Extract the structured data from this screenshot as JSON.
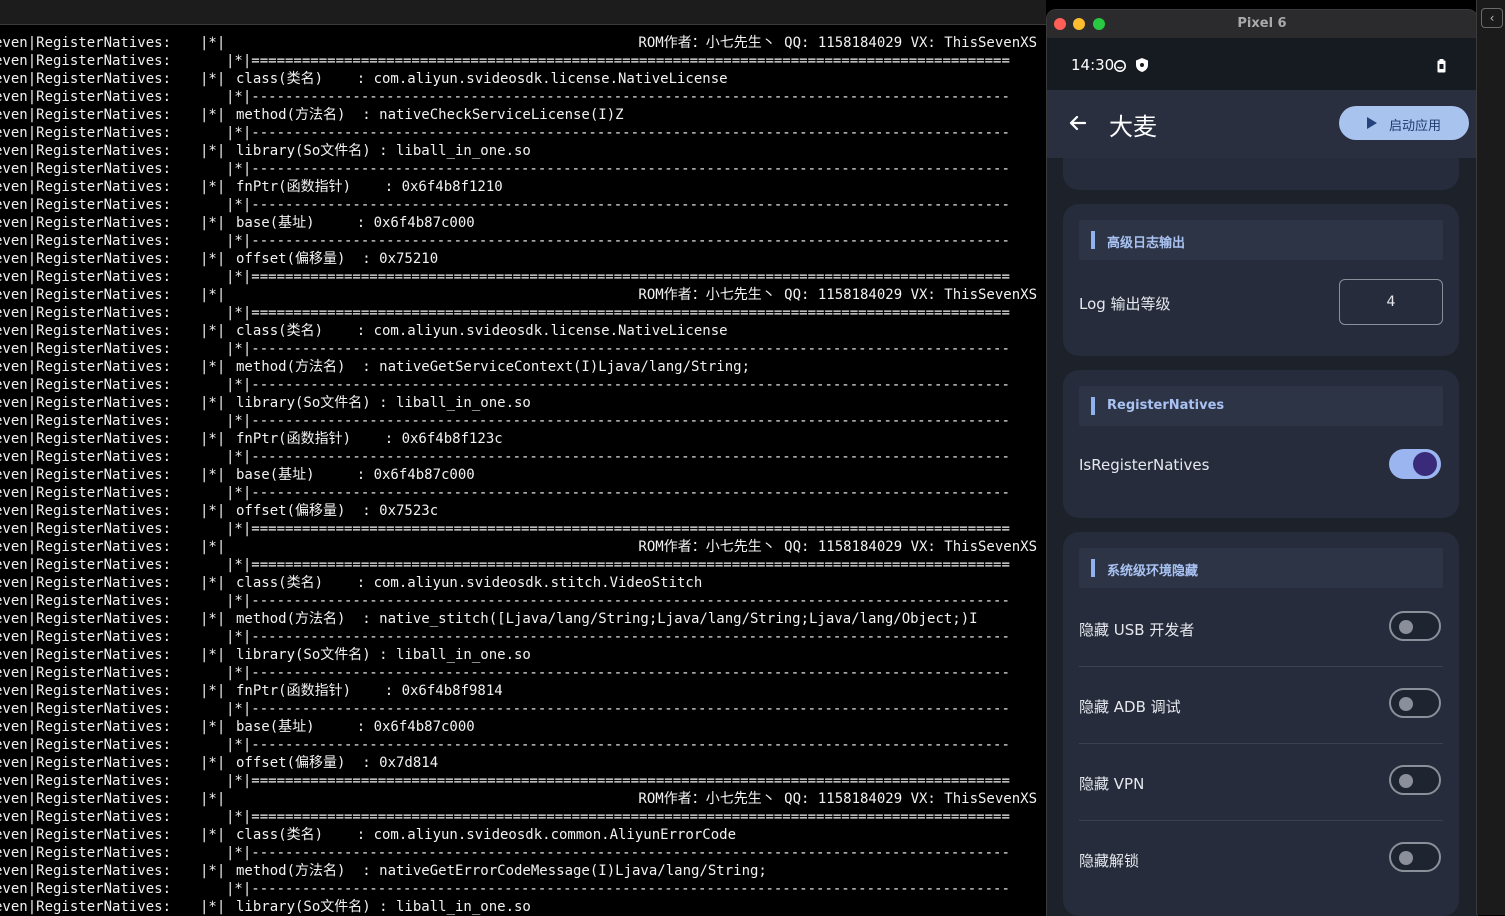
{
  "terminal": {
    "lines": [
      {
        "prefix": "even|RegisterNatives:",
        "kind": "header",
        "text": "ROM作者：小七先生丶 QQ: 1158184029 VX: ThisSevenXS"
      },
      {
        "prefix": "even|RegisterNatives:",
        "kind": "rule",
        "text": "|*|=========================================================================================="
      },
      {
        "prefix": "even|RegisterNatives:",
        "kind": "field",
        "text": "class(类名)    : com.aliyun.svideosdk.license.NativeLicense"
      },
      {
        "prefix": "even|RegisterNatives:",
        "kind": "rule",
        "text": "|*|------------------------------------------------------------------------------------------"
      },
      {
        "prefix": "even|RegisterNatives:",
        "kind": "field",
        "text": "method(方法名)  : nativeCheckServiceLicense(I)Z"
      },
      {
        "prefix": "even|RegisterNatives:",
        "kind": "rule",
        "text": "|*|------------------------------------------------------------------------------------------"
      },
      {
        "prefix": "even|RegisterNatives:",
        "kind": "field",
        "text": "library(So文件名) : liball_in_one.so"
      },
      {
        "prefix": "even|RegisterNatives:",
        "kind": "rule",
        "text": "|*|------------------------------------------------------------------------------------------"
      },
      {
        "prefix": "even|RegisterNatives:",
        "kind": "field",
        "text": "fnPtr(函数指针)    : 0x6f4b8f1210"
      },
      {
        "prefix": "even|RegisterNatives:",
        "kind": "rule",
        "text": "|*|------------------------------------------------------------------------------------------"
      },
      {
        "prefix": "even|RegisterNatives:",
        "kind": "field",
        "text": "base(基址)     : 0x6f4b87c000"
      },
      {
        "prefix": "even|RegisterNatives:",
        "kind": "rule",
        "text": "|*|------------------------------------------------------------------------------------------"
      },
      {
        "prefix": "even|RegisterNatives:",
        "kind": "field",
        "text": "offset(偏移量)  : 0x75210"
      },
      {
        "prefix": "even|RegisterNatives:",
        "kind": "rule",
        "text": "|*|=========================================================================================="
      },
      {
        "prefix": "even|RegisterNatives:",
        "kind": "header",
        "text": "ROM作者：小七先生丶 QQ: 1158184029 VX: ThisSevenXS"
      },
      {
        "prefix": "even|RegisterNatives:",
        "kind": "rule",
        "text": "|*|=========================================================================================="
      },
      {
        "prefix": "even|RegisterNatives:",
        "kind": "field",
        "text": "class(类名)    : com.aliyun.svideosdk.license.NativeLicense"
      },
      {
        "prefix": "even|RegisterNatives:",
        "kind": "rule",
        "text": "|*|------------------------------------------------------------------------------------------"
      },
      {
        "prefix": "even|RegisterNatives:",
        "kind": "field",
        "text": "method(方法名)  : nativeGetServiceContext(I)Ljava/lang/String;"
      },
      {
        "prefix": "even|RegisterNatives:",
        "kind": "rule",
        "text": "|*|------------------------------------------------------------------------------------------"
      },
      {
        "prefix": "even|RegisterNatives:",
        "kind": "field",
        "text": "library(So文件名) : liball_in_one.so"
      },
      {
        "prefix": "even|RegisterNatives:",
        "kind": "rule",
        "text": "|*|------------------------------------------------------------------------------------------"
      },
      {
        "prefix": "even|RegisterNatives:",
        "kind": "field",
        "text": "fnPtr(函数指针)    : 0x6f4b8f123c"
      },
      {
        "prefix": "even|RegisterNatives:",
        "kind": "rule",
        "text": "|*|------------------------------------------------------------------------------------------"
      },
      {
        "prefix": "even|RegisterNatives:",
        "kind": "field",
        "text": "base(基址)     : 0x6f4b87c000"
      },
      {
        "prefix": "even|RegisterNatives:",
        "kind": "rule",
        "text": "|*|------------------------------------------------------------------------------------------"
      },
      {
        "prefix": "even|RegisterNatives:",
        "kind": "field",
        "text": "offset(偏移量)  : 0x7523c"
      },
      {
        "prefix": "even|RegisterNatives:",
        "kind": "rule",
        "text": "|*|=========================================================================================="
      },
      {
        "prefix": "even|RegisterNatives:",
        "kind": "header",
        "text": "ROM作者：小七先生丶 QQ: 1158184029 VX: ThisSevenXS"
      },
      {
        "prefix": "even|RegisterNatives:",
        "kind": "rule",
        "text": "|*|=========================================================================================="
      },
      {
        "prefix": "even|RegisterNatives:",
        "kind": "field",
        "text": "class(类名)    : com.aliyun.svideosdk.stitch.VideoStitch"
      },
      {
        "prefix": "even|RegisterNatives:",
        "kind": "rule",
        "text": "|*|------------------------------------------------------------------------------------------"
      },
      {
        "prefix": "even|RegisterNatives:",
        "kind": "field",
        "text": "method(方法名)  : native_stitch([Ljava/lang/String;Ljava/lang/String;Ljava/lang/Object;)I"
      },
      {
        "prefix": "even|RegisterNatives:",
        "kind": "rule",
        "text": "|*|------------------------------------------------------------------------------------------"
      },
      {
        "prefix": "even|RegisterNatives:",
        "kind": "field",
        "text": "library(So文件名) : liball_in_one.so"
      },
      {
        "prefix": "even|RegisterNatives:",
        "kind": "rule",
        "text": "|*|------------------------------------------------------------------------------------------"
      },
      {
        "prefix": "even|RegisterNatives:",
        "kind": "field",
        "text": "fnPtr(函数指针)    : 0x6f4b8f9814"
      },
      {
        "prefix": "even|RegisterNatives:",
        "kind": "rule",
        "text": "|*|------------------------------------------------------------------------------------------"
      },
      {
        "prefix": "even|RegisterNatives:",
        "kind": "field",
        "text": "base(基址)     : 0x6f4b87c000"
      },
      {
        "prefix": "even|RegisterNatives:",
        "kind": "rule",
        "text": "|*|------------------------------------------------------------------------------------------"
      },
      {
        "prefix": "even|RegisterNatives:",
        "kind": "field",
        "text": "offset(偏移量)  : 0x7d814"
      },
      {
        "prefix": "even|RegisterNatives:",
        "kind": "rule",
        "text": "|*|=========================================================================================="
      },
      {
        "prefix": "even|RegisterNatives:",
        "kind": "header",
        "text": "ROM作者：小七先生丶 QQ: 1158184029 VX: ThisSevenXS"
      },
      {
        "prefix": "even|RegisterNatives:",
        "kind": "rule",
        "text": "|*|=========================================================================================="
      },
      {
        "prefix": "even|RegisterNatives:",
        "kind": "field",
        "text": "class(类名)    : com.aliyun.svideosdk.common.AliyunErrorCode"
      },
      {
        "prefix": "even|RegisterNatives:",
        "kind": "rule",
        "text": "|*|------------------------------------------------------------------------------------------"
      },
      {
        "prefix": "even|RegisterNatives:",
        "kind": "field",
        "text": "method(方法名)  : nativeGetErrorCodeMessage(I)Ljava/lang/String;"
      },
      {
        "prefix": "even|RegisterNatives:",
        "kind": "rule",
        "text": "|*|------------------------------------------------------------------------------------------"
      },
      {
        "prefix": "even|RegisterNatives:",
        "kind": "field",
        "text": "library(So文件名) : liball_in_one.so"
      }
    ],
    "pipe": "|*|"
  },
  "emulator": {
    "window_title": "Pixel 6",
    "status_time": "14:30",
    "app_title": "大麦",
    "launch_button_label": "启动应用",
    "sections": {
      "log": {
        "title": "高级日志输出",
        "log_level_label": "Log 输出等级",
        "log_level_value": "4"
      },
      "register": {
        "title": "RegisterNatives",
        "toggle_label": "IsRegisterNatives",
        "toggle_on": true
      },
      "hide": {
        "title": "系统级环境隐藏",
        "items": [
          {
            "label": "隐藏 USB 开发者",
            "on": false
          },
          {
            "label": "隐藏 ADB 调试",
            "on": false
          },
          {
            "label": "隐藏 VPN",
            "on": false
          },
          {
            "label": "隐藏解锁",
            "on": false
          }
        ]
      }
    }
  },
  "colors": {
    "terminal_bg": "#000000",
    "terminal_text": "#f2f2f2",
    "app_bg": "#1d2129",
    "card_bg": "#262c3b",
    "accent": "#a8c3ee",
    "traffic_red": "#ff5f57",
    "traffic_yellow": "#febc2e",
    "traffic_green": "#28c840"
  }
}
